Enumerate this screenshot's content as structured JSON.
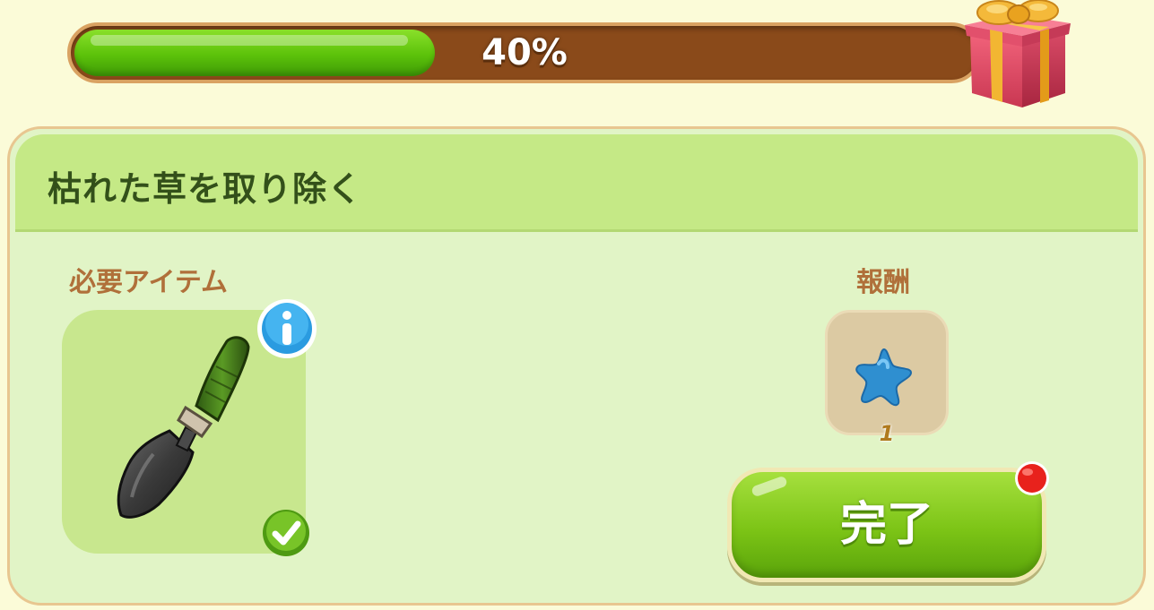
{
  "progress": {
    "percent_label": "40%",
    "value": 0.4
  },
  "task": {
    "title": "枯れた草を取り除く"
  },
  "required": {
    "label": "必要アイテム",
    "item_icon": "trowel-icon",
    "info_icon": "info-icon",
    "status_icon": "check-icon"
  },
  "reward": {
    "label": "報酬",
    "item_icon": "blue-star-icon",
    "count": "1"
  },
  "actions": {
    "complete_label": "完了"
  },
  "colors": {
    "progress_fill": "#5cc20a",
    "progress_track": "#8a4a1a",
    "panel_bg": "#e1f4c6",
    "header_bg": "#c5e986",
    "title_text": "#33501a",
    "label_text": "#b0703a",
    "button_green": "#7cc416",
    "notify_red": "#e8221c"
  }
}
